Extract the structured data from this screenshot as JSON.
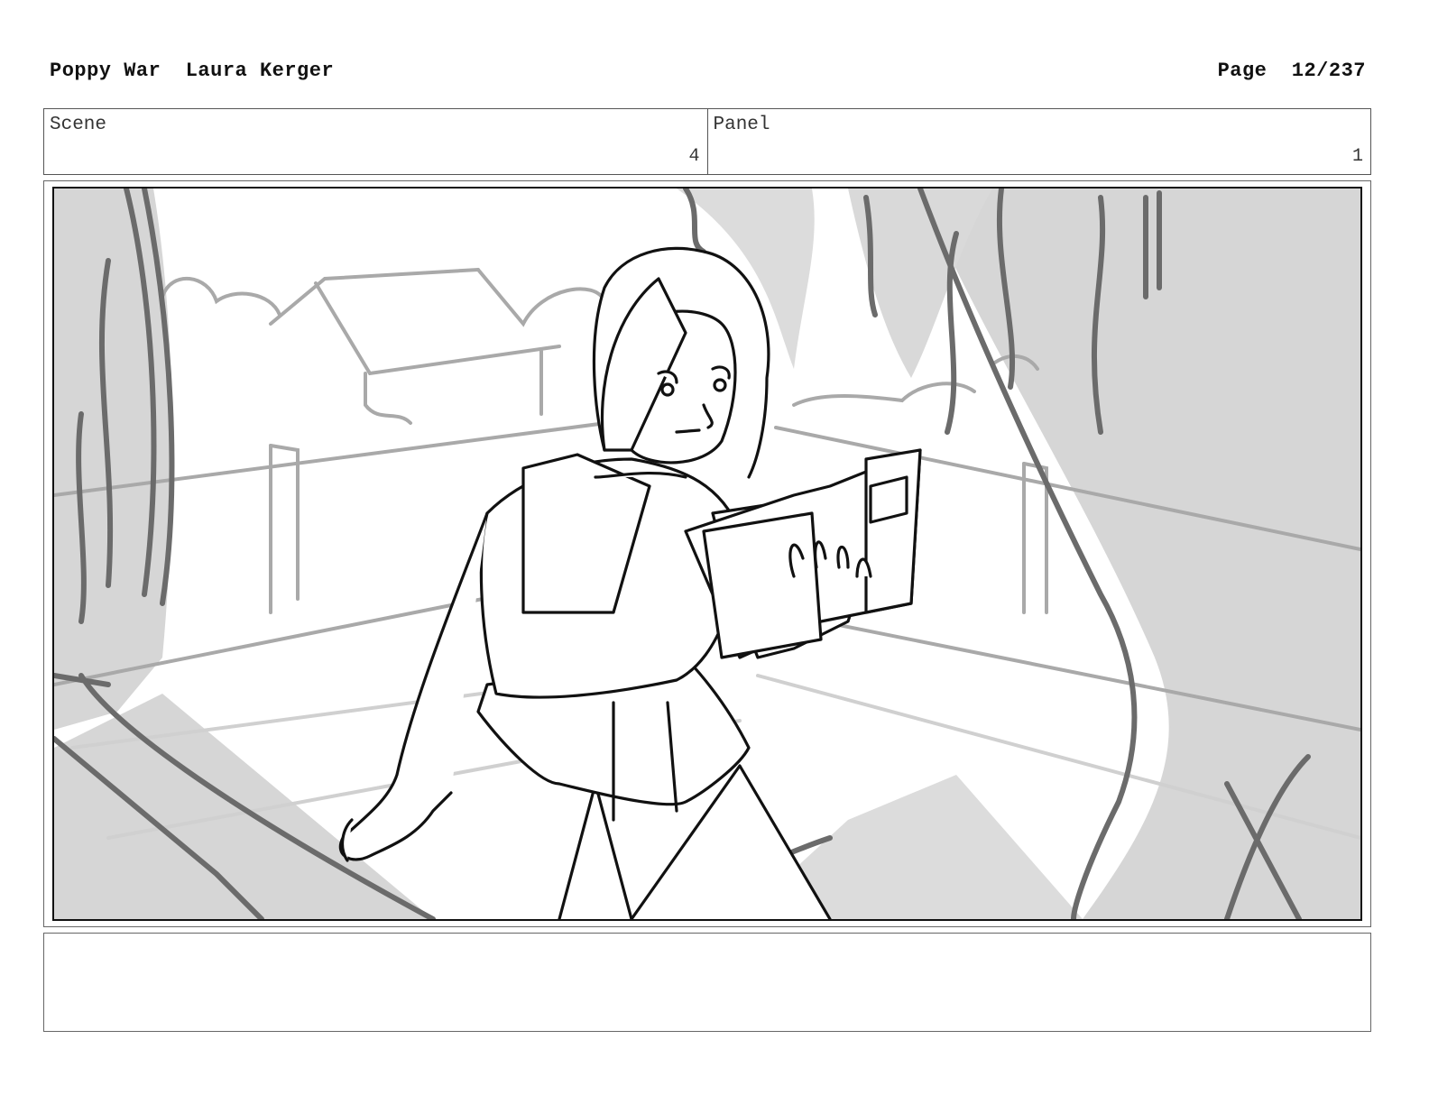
{
  "header": {
    "project": "Poppy War",
    "author": "Laura Kerger",
    "page_label": "Page",
    "page_number": "12/237"
  },
  "meta": {
    "scene_label": "Scene",
    "scene_value": "4",
    "panel_label": "Panel",
    "panel_value": "1"
  },
  "notes": {
    "text": ""
  }
}
